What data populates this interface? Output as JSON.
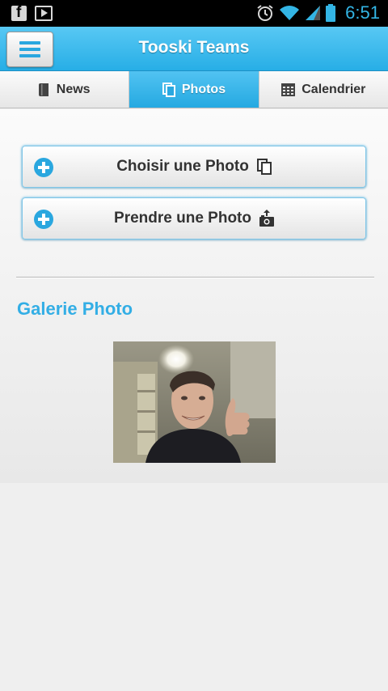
{
  "status_bar": {
    "time": "6:51",
    "left_icons": [
      "facebook-icon",
      "play-store-icon"
    ],
    "right_icons": [
      "alarm-icon",
      "wifi-icon",
      "signal-icon",
      "battery-icon"
    ]
  },
  "header": {
    "title": "Tooski Teams",
    "menu_icon": "hamburger-menu-icon",
    "accent": "#33b5e5"
  },
  "tabs": [
    {
      "label": "News",
      "icon": "book-icon",
      "active": false
    },
    {
      "label": "Photos",
      "icon": "copy-icon",
      "active": true
    },
    {
      "label": "Calendrier",
      "icon": "calendar-icon",
      "active": false
    }
  ],
  "actions": [
    {
      "label": "Choisir une Photo",
      "icon": "copy-icon",
      "lead_icon": "plus-circle-icon"
    },
    {
      "label": "Prendre une Photo",
      "icon": "camera-upload-icon",
      "lead_icon": "plus-circle-icon"
    }
  ],
  "gallery": {
    "title": "Galerie Photo",
    "photos": [
      "smiling-young-man-thumbs-up-photo"
    ]
  }
}
